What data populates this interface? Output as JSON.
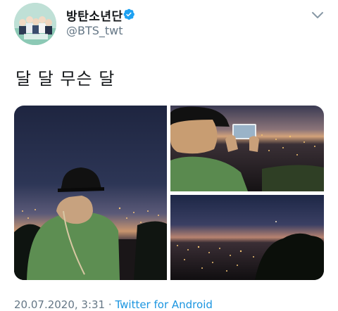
{
  "author": {
    "display_name": "방탄소년단",
    "handle": "@BTS_twt",
    "verified": true,
    "verified_icon": "verified-badge-icon",
    "verified_color": "#1da1f2"
  },
  "tweet": {
    "text": "달 달 무슨 달",
    "more_icon": "chevron-down-icon"
  },
  "media": {
    "count": 3,
    "photos": [
      {
        "subject": "person in green shirt and black cap overlooking night city at dusk"
      },
      {
        "subject": "person photographing night city skyline with phone"
      },
      {
        "subject": "night city lights below twilight sky"
      }
    ]
  },
  "footer": {
    "timestamp": "20.07.2020, 3:31",
    "separator": "·",
    "source": "Twitter for Android"
  },
  "colors": {
    "text": "#14171a",
    "secondary": "#657786",
    "link": "#1b95e0"
  }
}
